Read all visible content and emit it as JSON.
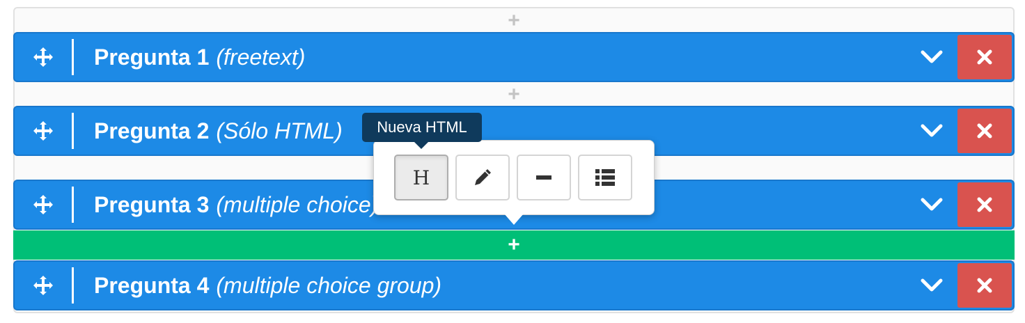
{
  "colors": {
    "question_bg": "#1d8ae6",
    "delete_bg": "#d9534f",
    "active_add_bg": "#00bf77",
    "tooltip_bg": "#0f3a5c"
  },
  "add_gaps": [
    {
      "label": "+",
      "active": false
    },
    {
      "label": "+",
      "active": false
    },
    {
      "label": "+",
      "active": true
    }
  ],
  "questions": [
    {
      "name": "Pregunta 1",
      "type": "(freetext)"
    },
    {
      "name": "Pregunta 2",
      "type": "(Sólo HTML)"
    },
    {
      "name": "Pregunta 3",
      "type": "(multiple choice)"
    },
    {
      "name": "Pregunta 4",
      "type": "(multiple choice group)"
    }
  ],
  "icons": {
    "drag": "move-icon",
    "collapse": "chevron-down-icon",
    "delete": "close-icon"
  },
  "popover": {
    "tooltip": "Nueva HTML",
    "buttons": [
      {
        "icon": "heading-icon",
        "label": "H",
        "active": true
      },
      {
        "icon": "pencil-icon",
        "active": false
      },
      {
        "icon": "minus-icon",
        "active": false
      },
      {
        "icon": "list-icon",
        "active": false
      }
    ]
  }
}
